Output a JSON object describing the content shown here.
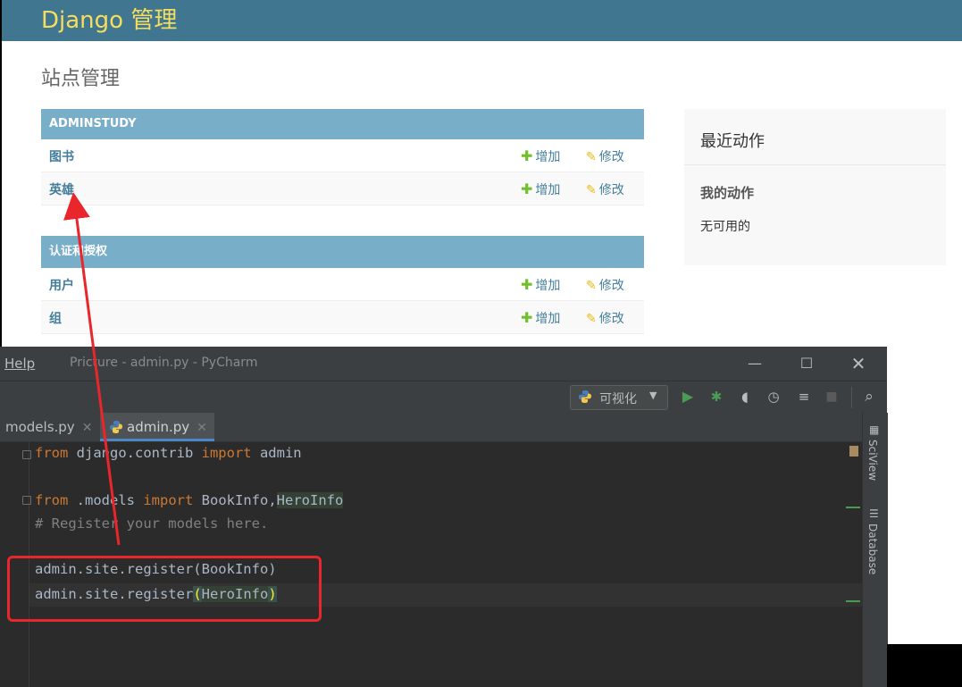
{
  "browser": {
    "header_title": "Django 管理",
    "site_title": "站点管理",
    "modules": [
      {
        "caption": "ADMINSTUDY",
        "rows": [
          {
            "name": "图书",
            "add": "增加",
            "change": "修改"
          },
          {
            "name": "英雄",
            "add": "增加",
            "change": "修改"
          }
        ]
      },
      {
        "caption": "认证和授权",
        "rows": [
          {
            "name": "用户",
            "add": "增加",
            "change": "修改"
          },
          {
            "name": "组",
            "add": "增加",
            "change": "修改"
          }
        ]
      }
    ],
    "recent": {
      "title": "最近动作",
      "mine_title": "我的动作",
      "none": "无可用的"
    }
  },
  "ide": {
    "menu_help": "Help",
    "window_title": "Pricture - admin.py - PyCharm",
    "run_config": "可视化",
    "tabs": [
      {
        "label": "models.py"
      },
      {
        "label": "admin.py"
      }
    ],
    "code": {
      "l1_kw": "from",
      "l1_rest": " django.contrib ",
      "l1_kw2": "import",
      "l1_end": " admin",
      "l2_kw": "from",
      "l2_rest": " .models ",
      "l2_kw2": "import",
      "l2_mid": " BookInfo",
      "l2_comma": ",",
      "l2_hl": "HeroInfo",
      "l3_comment": "# Register your models here.",
      "l4": "admin.site.register(BookInfo)",
      "l5_pre": "admin.site.register",
      "l5_open": "(",
      "l5_hl": "HeroInfo",
      "l5_close": ")"
    },
    "side_tools": [
      "SciView",
      "Database"
    ]
  },
  "colors": {
    "django_header": "#417690",
    "module_caption": "#79aec8",
    "annotation": "#e8262b",
    "keyword": "#cc7832"
  }
}
